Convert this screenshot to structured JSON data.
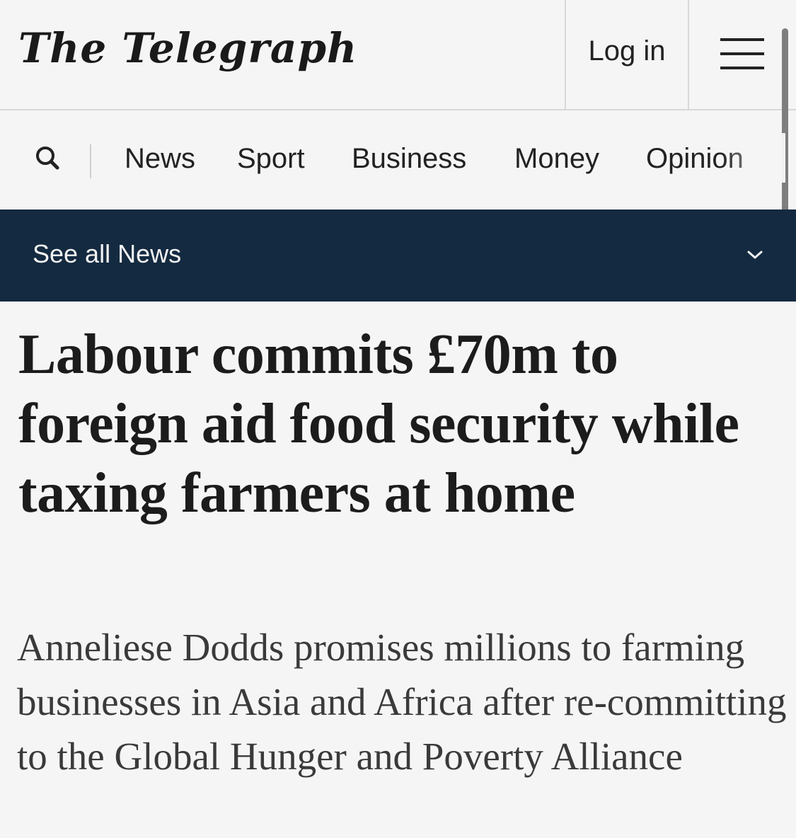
{
  "header": {
    "logo_text": "The Telegraph",
    "login_label": "Log in",
    "menu_icon": "hamburger-menu-icon"
  },
  "nav": {
    "search_icon": "search-icon",
    "items": [
      {
        "label": "News"
      },
      {
        "label": "Sport"
      },
      {
        "label": "Business"
      },
      {
        "label": "Money"
      },
      {
        "label": "Opinion"
      }
    ]
  },
  "section": {
    "label": "See all News",
    "chevron_icon": "chevron-down-icon",
    "bar_color": "#142a40"
  },
  "article": {
    "headline": "Labour commits £70m to foreign aid food security while taxing farmers at home",
    "standfirst": "Anneliese Dodds promises millions to farming businesses in Asia and Africa after re-committing to the Global Hunger and Poverty Alliance"
  }
}
